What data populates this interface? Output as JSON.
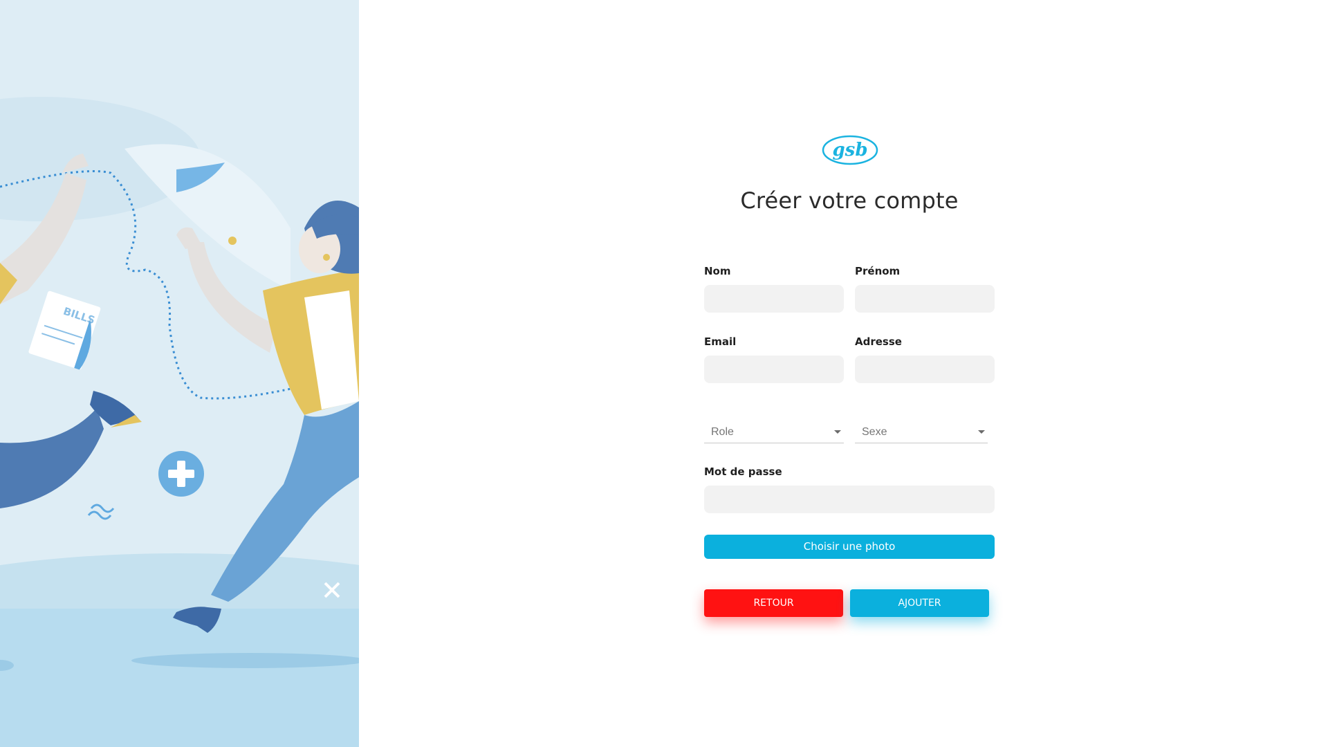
{
  "brand": {
    "logo_text": "gsb",
    "logo_color": "#1ab3e0"
  },
  "page": {
    "title": "Créer votre compte"
  },
  "form": {
    "nom": {
      "label": "Nom",
      "value": ""
    },
    "prenom": {
      "label": "Prénom",
      "value": ""
    },
    "email": {
      "label": "Email",
      "value": ""
    },
    "adresse": {
      "label": "Adresse",
      "value": ""
    },
    "role": {
      "placeholder": "Role"
    },
    "sexe": {
      "placeholder": "Sexe"
    },
    "password": {
      "label": "Mot de passe",
      "value": ""
    }
  },
  "buttons": {
    "photo": "Choisir une photo",
    "back": "RETOUR",
    "add": "AJOUTER"
  },
  "illustration": {
    "bills_text": "BILLS"
  },
  "colors": {
    "accent": "#0bb0dd",
    "danger": "#ff1212",
    "input_bg": "#f2f2f2",
    "panel_bg": "#deedf5"
  }
}
